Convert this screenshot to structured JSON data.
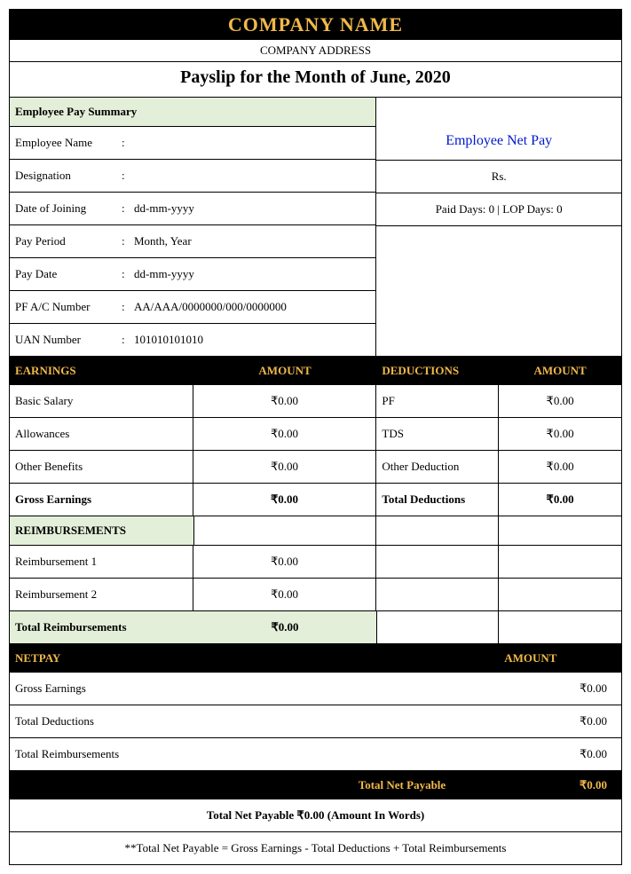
{
  "company": {
    "name": "COMPANY NAME",
    "address": "COMPANY ADDRESS"
  },
  "title": "Payslip for the Month of June, 2020",
  "summary_heading": "Employee Pay Summary",
  "employee": {
    "name_label": "Employee Name",
    "name_value": "",
    "designation_label": "Designation",
    "designation_value": "",
    "doj_label": "Date of Joining",
    "doj_value": "dd-mm-yyyy",
    "period_label": "Pay Period",
    "period_value": "Month, Year",
    "paydate_label": "Pay Date",
    "paydate_value": "dd-mm-yyyy",
    "pf_label": "PF A/C Number",
    "pf_value": "AA/AAA/0000000/000/0000000",
    "uan_label": "UAN Number",
    "uan_value": "101010101010"
  },
  "netpay_side": {
    "title": "Employee Net Pay",
    "amount": "Rs.",
    "days": "Paid Days: 0 | LOP Days: 0"
  },
  "headers": {
    "earnings": "EARNINGS",
    "deductions": "DEDUCTIONS",
    "amount": "AMOUNT",
    "reimbursements": "REIMBURSEMENTS",
    "netpay": "NETPAY"
  },
  "earnings": {
    "basic_label": "Basic Salary",
    "basic_amt": "₹0.00",
    "allow_label": "Allowances",
    "allow_amt": "₹0.00",
    "other_label": "Other Benefits",
    "other_amt": "₹0.00",
    "gross_label": "Gross Earnings",
    "gross_amt": "₹0.00"
  },
  "deductions": {
    "pf_label": "PF",
    "pf_amt": "₹0.00",
    "tds_label": "TDS",
    "tds_amt": "₹0.00",
    "other_label": "Other Deduction",
    "other_amt": "₹0.00",
    "total_label": "Total Deductions",
    "total_amt": "₹0.00"
  },
  "reimb": {
    "r1_label": "Reimbursement 1",
    "r1_amt": "₹0.00",
    "r2_label": "Reimbursement 2",
    "r2_amt": "₹0.00",
    "total_label": "Total Reimbursements",
    "total_amt": "₹0.00"
  },
  "netpay": {
    "gross_label": "Gross Earnings",
    "gross_amt": "₹0.00",
    "ded_label": "Total Deductions",
    "ded_amt": "₹0.00",
    "reimb_label": "Total Reimbursements",
    "reimb_amt": "₹0.00",
    "total_label": "Total Net Payable",
    "total_amt": "₹0.00"
  },
  "footer": {
    "words": "Total Net Payable ₹0.00 (Amount In Words)",
    "formula": "**Total Net Payable = Gross Earnings - Total Deductions + Total Reimbursements"
  },
  "colon": ":"
}
